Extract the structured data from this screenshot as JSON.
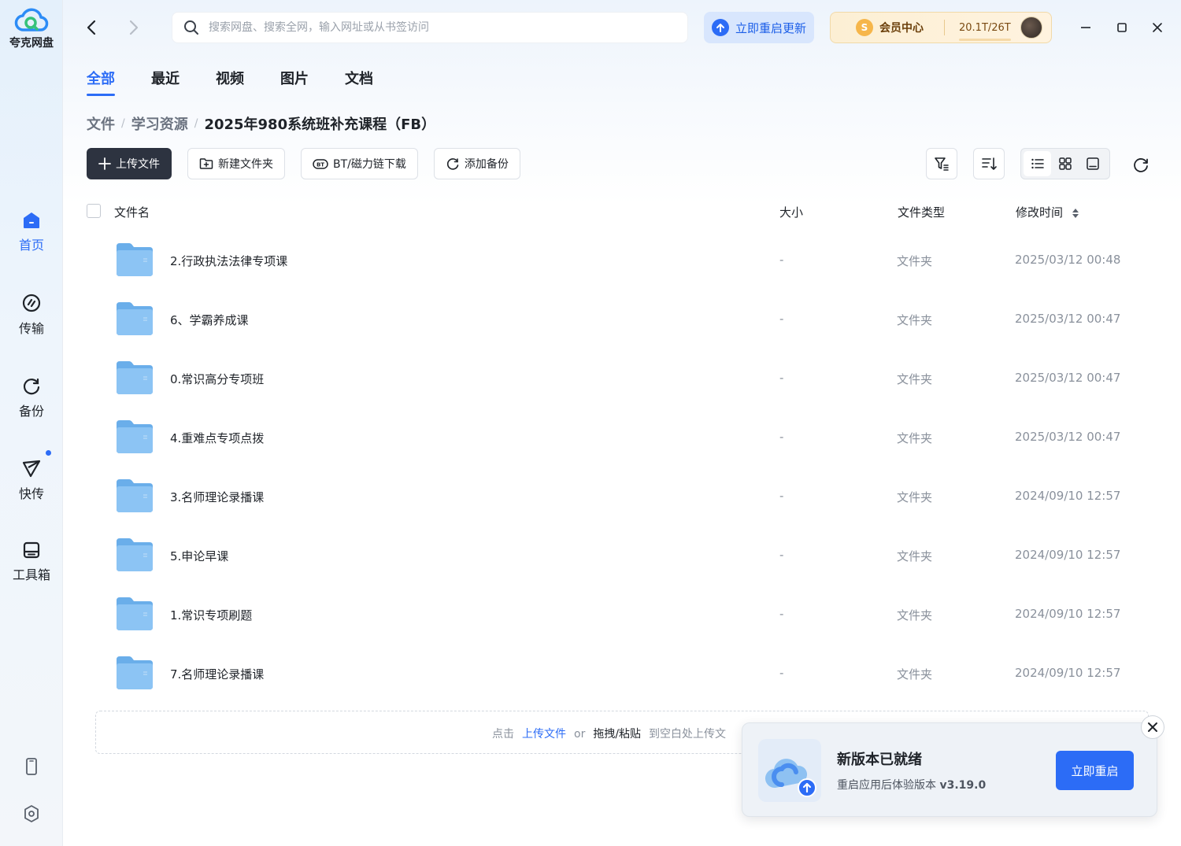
{
  "app": {
    "logo_text": "夸克网盘"
  },
  "sidebar": {
    "items": [
      {
        "label": "首页",
        "icon": "home-icon"
      },
      {
        "label": "传输",
        "icon": "transfer-icon"
      },
      {
        "label": "备份",
        "icon": "backup-icon"
      },
      {
        "label": "快传",
        "icon": "send-icon"
      },
      {
        "label": "工具箱",
        "icon": "toolbox-icon"
      }
    ],
    "bottom": [
      {
        "icon": "phone-icon"
      },
      {
        "icon": "settings-icon"
      }
    ]
  },
  "topbar": {
    "search_placeholder": "搜索网盘、搜索全网，输入网址或从书签访问",
    "update_label": "立即重启更新",
    "member_label": "会员中心",
    "quota": "20.1T/26T",
    "quota_fraction": 0.77
  },
  "tabs": [
    {
      "label": "全部",
      "active": true
    },
    {
      "label": "最近",
      "active": false
    },
    {
      "label": "视频",
      "active": false
    },
    {
      "label": "图片",
      "active": false
    },
    {
      "label": "文档",
      "active": false
    }
  ],
  "breadcrumb": {
    "items": [
      "文件",
      "学习资源"
    ],
    "separator": "/",
    "current": "2025年980系统班补充课程（FB）"
  },
  "actions": {
    "upload": "上传文件",
    "new_folder": "新建文件夹",
    "bt": "BT/磁力链下载",
    "backup": "添加备份"
  },
  "table": {
    "headers": {
      "name": "文件名",
      "size": "大小",
      "type": "文件类型",
      "modified": "修改时间"
    },
    "rows": [
      {
        "name": "2.行政执法法律专项课",
        "size": "-",
        "type": "文件夹",
        "modified": "2025/03/12 00:48"
      },
      {
        "name": "6、学霸养成课",
        "size": "-",
        "type": "文件夹",
        "modified": "2025/03/12 00:47"
      },
      {
        "name": "0.常识高分专项班",
        "size": "-",
        "type": "文件夹",
        "modified": "2025/03/12 00:47"
      },
      {
        "name": "4.重难点专项点拨",
        "size": "-",
        "type": "文件夹",
        "modified": "2025/03/12 00:47"
      },
      {
        "name": "3.名师理论录播课",
        "size": "-",
        "type": "文件夹",
        "modified": "2024/09/10 12:57"
      },
      {
        "name": "5.申论早课",
        "size": "-",
        "type": "文件夹",
        "modified": "2024/09/10 12:57"
      },
      {
        "name": "1.常识专项刷题",
        "size": "-",
        "type": "文件夹",
        "modified": "2024/09/10 12:57"
      },
      {
        "name": "7.名师理论录播课",
        "size": "-",
        "type": "文件夹",
        "modified": "2024/09/10 12:57"
      }
    ]
  },
  "dropzone": {
    "prefix": "点击",
    "link": "上传文件",
    "or": "or",
    "bold": "拖拽/粘贴",
    "suffix": "到空白处上传文"
  },
  "toast": {
    "title": "新版本已就绪",
    "desc_prefix": "重启应用后体验版本 ",
    "version": "v3.19.0",
    "button": "立即重启"
  },
  "colors": {
    "accent": "#2c6cf6",
    "primary_button": "#2d3340",
    "folder": "#7fb8f0"
  }
}
